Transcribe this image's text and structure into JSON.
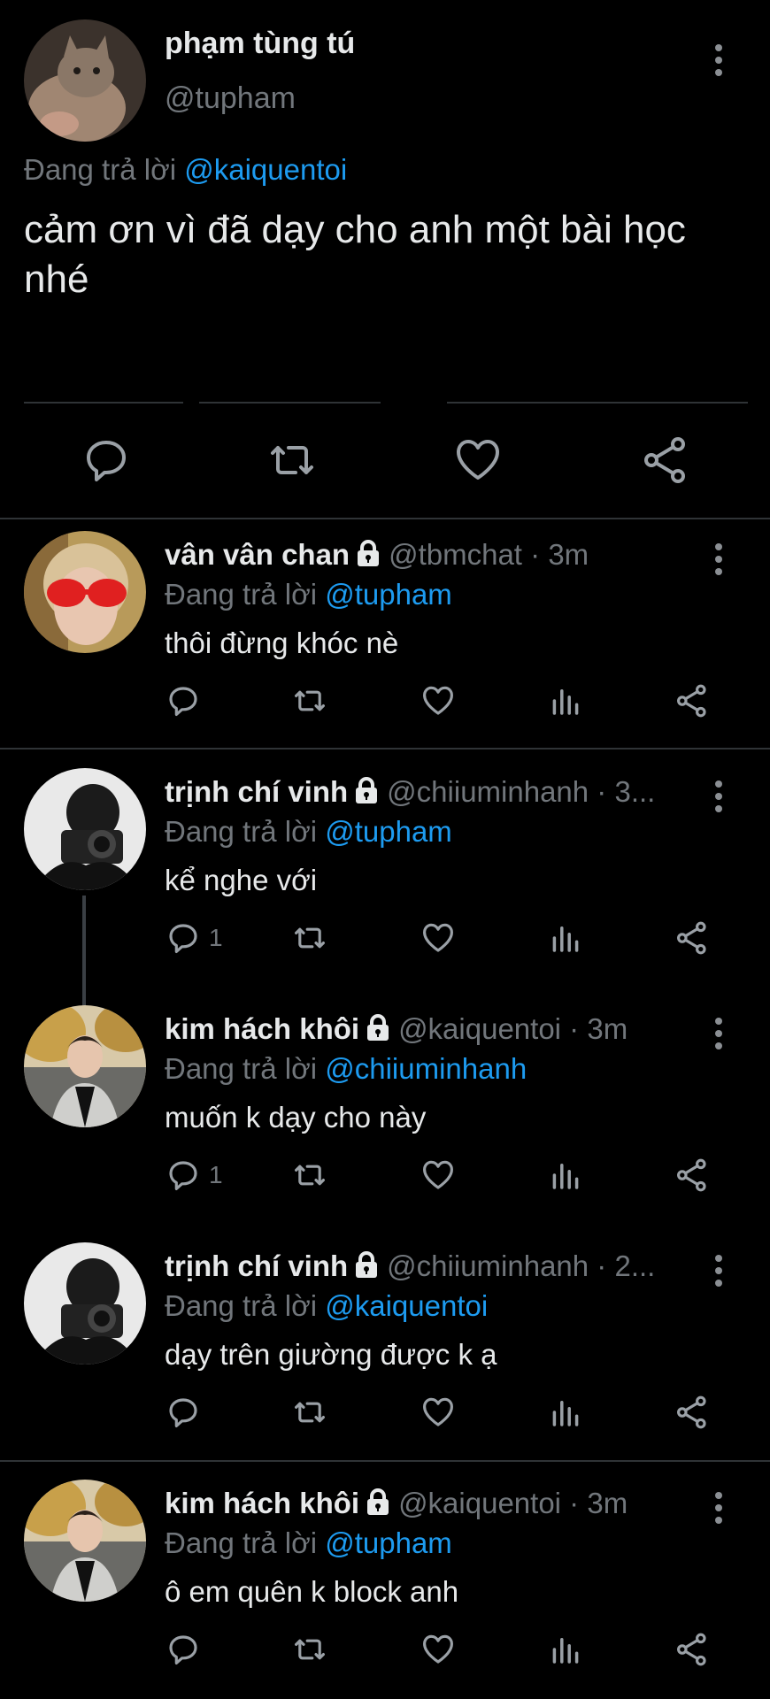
{
  "main": {
    "name": "phạm tùng tú",
    "handle": "@tupham",
    "replying_prefix": "Đang trả lời ",
    "replying_to": "@kaiquentoi",
    "text": "cảm ơn vì đã dạy cho anh một bài học nhé",
    "avatar": "cat-photo"
  },
  "colors": {
    "background": "#000000",
    "text": "#e7e9ea",
    "muted": "#71767b",
    "link": "#1d9bf0",
    "divider": "#2f3336"
  },
  "replies": [
    {
      "name": "vân vân chan",
      "handle": "@tbmchat",
      "time": "3m",
      "replying_prefix": "Đang trả lời ",
      "replying_to": "@tupham",
      "text": "thôi đừng khóc nè",
      "reply_count": ""
    },
    {
      "name": "trịnh chí vinh",
      "handle": "@chiiuminhanh",
      "time": "3...",
      "replying_prefix": "Đang trả lời ",
      "replying_to": "@tupham",
      "text": "kể nghe với",
      "reply_count": "1"
    },
    {
      "name": "kim hách khôi",
      "handle": "@kaiquentoi",
      "time": "3m",
      "replying_prefix": "Đang trả lời ",
      "replying_to": "@chiiuminhanh",
      "text": "muốn k dạy cho này",
      "reply_count": "1"
    },
    {
      "name": "trịnh chí vinh",
      "handle": "@chiiuminhanh",
      "time": "2...",
      "replying_prefix": "Đang trả lời ",
      "replying_to": "@kaiquentoi",
      "text": "dạy trên giường được k ạ",
      "reply_count": ""
    },
    {
      "name": "kim hách khôi",
      "handle": "@kaiquentoi",
      "time": "3m",
      "replying_prefix": "Đang trả lời ",
      "replying_to": "@tupham",
      "text": "ô em quên k block anh",
      "reply_count": ""
    }
  ],
  "icons": {
    "reply": "reply-icon",
    "retweet": "retweet-icon",
    "like": "heart-icon",
    "analytics": "analytics-icon",
    "share": "share-icon",
    "more": "more-vertical-icon",
    "lock": "lock-icon"
  }
}
